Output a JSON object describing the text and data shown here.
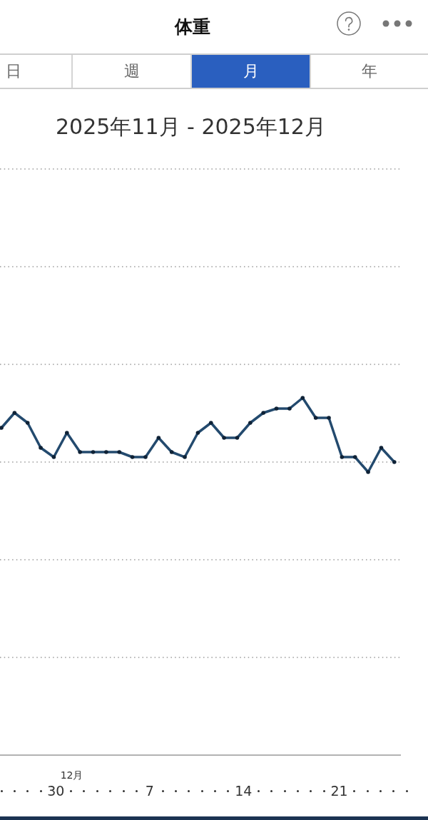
{
  "header": {
    "title": "体重"
  },
  "tabs": [
    {
      "label": "日",
      "selected": false
    },
    {
      "label": "週",
      "selected": false
    },
    {
      "label": "月",
      "selected": true
    },
    {
      "label": "年",
      "selected": false
    }
  ],
  "period": "2025年11月 - 2025年12月",
  "chart": {
    "month_label": "12月",
    "day_labels": [
      "30",
      "7",
      "14",
      "21"
    ]
  }
}
